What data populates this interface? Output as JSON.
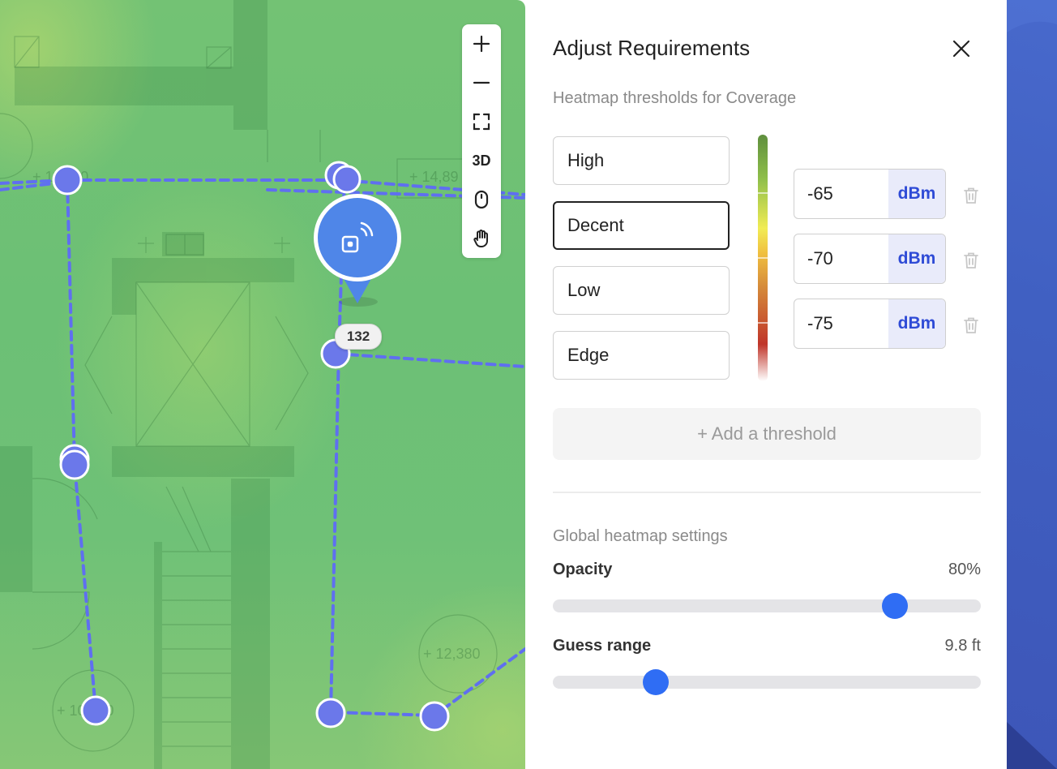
{
  "map": {
    "room_labels": [
      "+ 11,360",
      "+ 14,89",
      "+ 12,380",
      "+ 10,360"
    ],
    "ap_badge": "132",
    "toolbar": {
      "zoom_in_icon": "plus-icon",
      "zoom_out_icon": "minus-icon",
      "fit_icon": "fullscreen-icon",
      "view_3d_label": "3D",
      "mouse_icon": "mouse-icon",
      "pan_icon": "hand-icon"
    },
    "colors": {
      "route": "#5f6ff0",
      "node": "#6b78ea"
    }
  },
  "panel": {
    "title": "Adjust Requirements",
    "subtitle": "Heatmap thresholds for Coverage",
    "levels": [
      {
        "label": "High",
        "selected": false
      },
      {
        "label": "Decent",
        "selected": true
      },
      {
        "label": "Low",
        "selected": false
      },
      {
        "label": "Edge",
        "selected": false
      }
    ],
    "thresholds": [
      {
        "value": "-65",
        "unit": "dBm"
      },
      {
        "value": "-70",
        "unit": "dBm"
      },
      {
        "value": "-75",
        "unit": "dBm"
      }
    ],
    "add_threshold": "+ Add a threshold",
    "global_settings": "Global heatmap settings",
    "opacity": {
      "label": "Opacity",
      "value": "80%",
      "fraction": 0.8
    },
    "guess_range": {
      "label": "Guess range",
      "value": "9.8 ft",
      "fraction": 0.24
    },
    "colors": {
      "accent": "#2f6df4",
      "unit_bg": "#e9ebfa",
      "unit_text": "#2f4bd6"
    }
  }
}
